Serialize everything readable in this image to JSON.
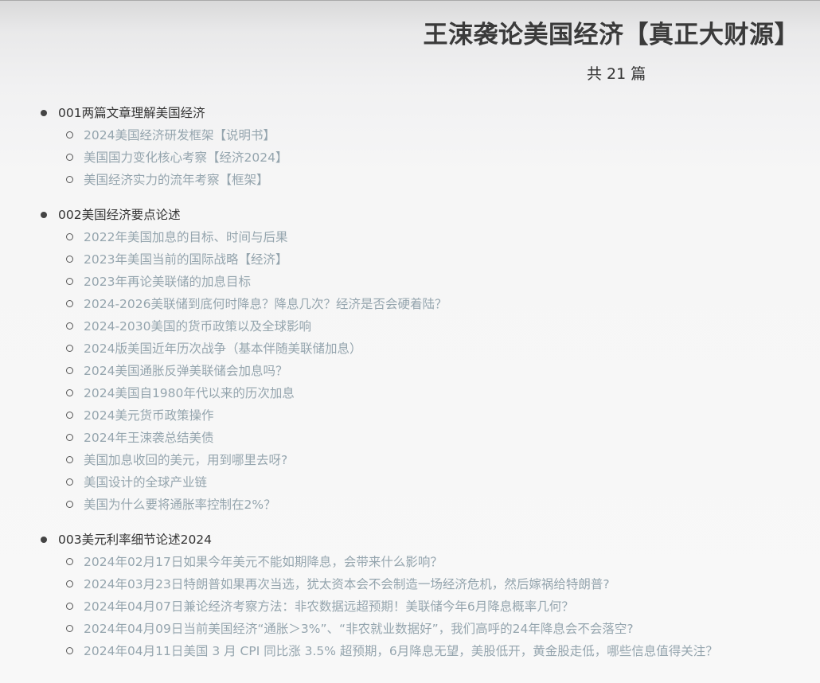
{
  "header": {
    "title": "王涑袭论美国经济【真正大财源】",
    "count_prefix": "共",
    "count_value": "21",
    "count_suffix": "篇"
  },
  "sections": [
    {
      "title": "001两篇文章理解美国经济",
      "items": [
        "2024美国经济研发框架【说明书】",
        "美国国力变化核心考察【经济2024】",
        "美国经济实力的流年考察【框架】"
      ]
    },
    {
      "title": "002美国经济要点论述",
      "items": [
        "2022年美国加息的目标、时间与后果",
        "2023年美国当前的国际战略【经济】",
        "2023年再论美联储的加息目标",
        "2024-2026美联储到底何时降息？降息几次？经济是否会硬着陆？",
        "2024-2030美国的货币政策以及全球影响",
        "2024版美国近年历次战争（基本伴随美联储加息）",
        "2024美国通胀反弹美联储会加息吗？",
        "2024美国自1980年代以来的历次加息",
        "2024美元货币政策操作",
        "2024年王涑袭总结美债",
        "美国加息收回的美元，用到哪里去呀?",
        "美国设计的全球产业链",
        "美国为什么要将通胀率控制在2%？"
      ]
    },
    {
      "title": "003美元利率细节论述2024",
      "items": [
        "2024年02月17日如果今年美元不能如期降息，会带来什么影响？",
        "2024年03月23日特朗普如果再次当选，犹太资本会不会制造一场经济危机，然后嫁祸给特朗普?",
        "2024年04月07日兼论经济考察方法：非农数据远超预期！美联储今年6月降息概率几何？",
        "2024年04月09日当前美国经济“通胀＞3%”、“非农就业数据好”，我们高呼的24年降息会不会落空?",
        "2024年04月11日美国 3 月 CPI 同比涨 3.5% 超预期，6月降息无望，美股低开，黄金股走低，哪些信息值得关注？"
      ]
    }
  ]
}
